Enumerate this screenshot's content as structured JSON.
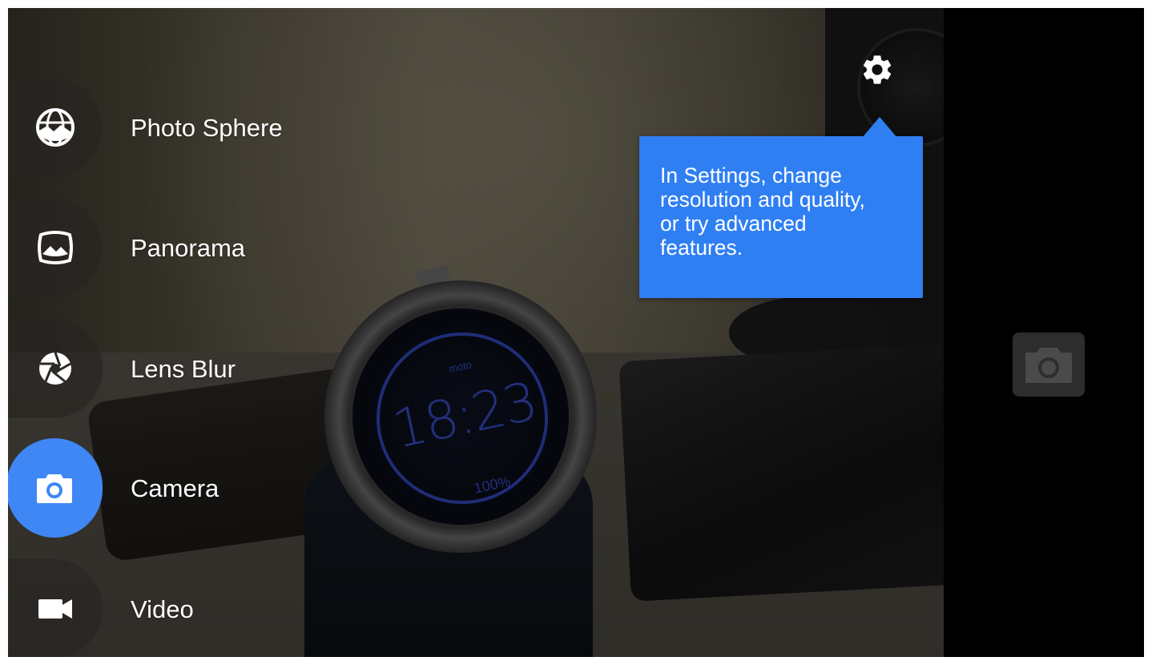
{
  "modes": [
    {
      "label": "Photo Sphere",
      "icon": "photo-sphere-icon",
      "active": false
    },
    {
      "label": "Panorama",
      "icon": "panorama-icon",
      "active": false
    },
    {
      "label": "Lens Blur",
      "icon": "lens-blur-icon",
      "active": false
    },
    {
      "label": "Camera",
      "icon": "camera-icon",
      "active": true
    },
    {
      "label": "Video",
      "icon": "video-icon",
      "active": false
    }
  ],
  "settings": {
    "icon": "gear-icon",
    "tip_line1": "In Settings, change",
    "tip_line2": "resolution and quality,",
    "tip_line3": "or try advanced",
    "tip_line4": "features."
  },
  "shutter": {
    "icon": "camera-shutter-icon"
  },
  "viewfinder": {
    "watch_brand": "moto",
    "watch_time": "18:23",
    "watch_battery": "100%"
  },
  "colors": {
    "accent": "#3e87f4",
    "tooltip": "#2f7ff3",
    "control_strip": "#000000"
  }
}
